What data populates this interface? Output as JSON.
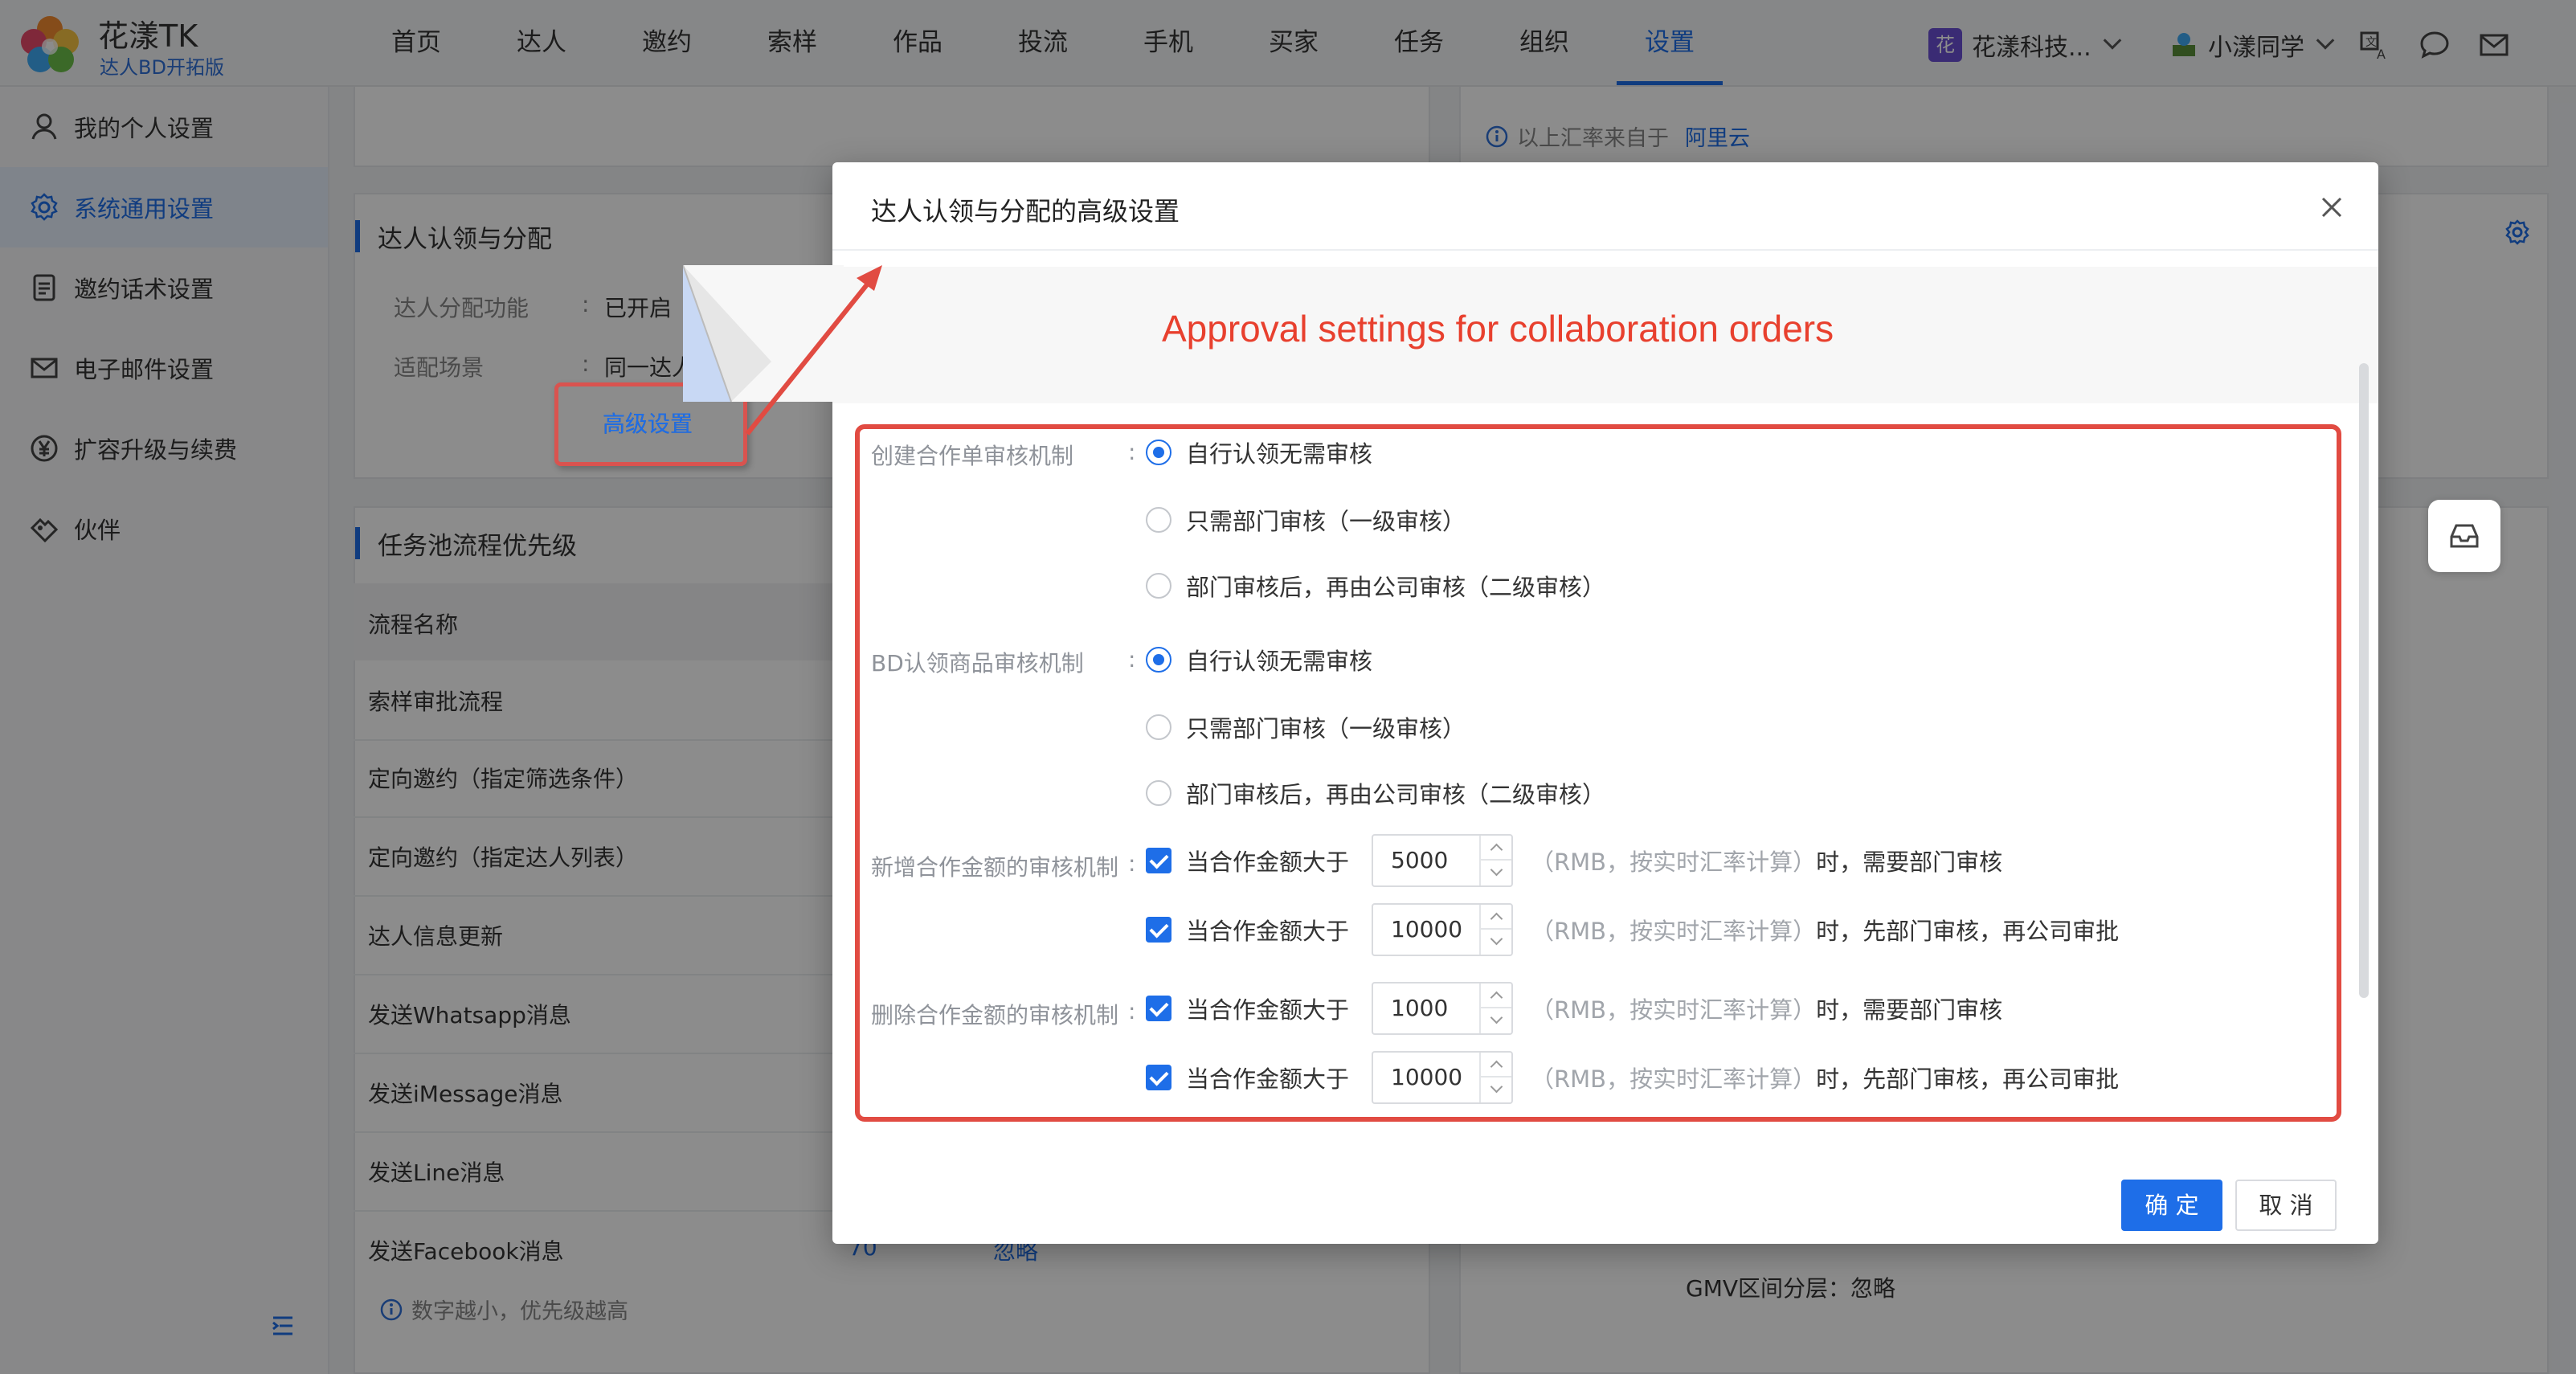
{
  "brand": {
    "name": "花漾TK",
    "sub": "达人BD开拓版"
  },
  "nav": [
    "首页",
    "达人",
    "邀约",
    "索样",
    "作品",
    "投流",
    "手机",
    "买家",
    "任务",
    "组织",
    "设置"
  ],
  "header": {
    "org_badge": "花",
    "org_name": "花漾科技...",
    "user_name": "小漾同学"
  },
  "sidebar": {
    "items": [
      {
        "label": "我的个人设置",
        "icon": "user-icon"
      },
      {
        "label": "系统通用设置",
        "icon": "gear-icon",
        "active": true
      },
      {
        "label": "邀约话术设置",
        "icon": "document-icon"
      },
      {
        "label": "电子邮件设置",
        "icon": "mail-icon"
      },
      {
        "label": "扩容升级与续费",
        "icon": "yen-icon"
      },
      {
        "label": "伙伴",
        "icon": "handshake-icon"
      }
    ]
  },
  "background": {
    "rate_hint": "以上汇率来自于",
    "rate_source": "阿里云",
    "claim_section": {
      "title": "达人认领与分配",
      "function_label": "达人分配功能",
      "function_value": "已开启",
      "scene_label": "适配场景",
      "scene_value": "同一达人",
      "advanced_link": "高级设置"
    },
    "task_section": {
      "title": "任务池流程优先级",
      "column": "流程名称",
      "rows": [
        "索样审批流程",
        "定向邀约（指定筛选条件）",
        "定向邀约（指定达人列表）",
        "达人信息更新",
        "发送Whatsapp消息",
        "发送iMessage消息",
        "发送Line消息",
        "发送Facebook消息"
      ],
      "last_row_priority": "70",
      "last_row_action": "忽略",
      "hint": "数字越小，优先级越高"
    },
    "gmv_text": "GMV区间分层：忽略"
  },
  "modal": {
    "title": "达人认领与分配的高级设置",
    "banner": "Approval settings for collaboration orders",
    "create_order": {
      "label": "创建合作单审核机制",
      "options": [
        "自行认领无需审核",
        "只需部门审核（一级审核）",
        "部门审核后，再由公司审核（二级审核）"
      ],
      "selected": 0
    },
    "bd_claim": {
      "label": "BD认领商品审核机制",
      "options": [
        "自行认领无需审核",
        "只需部门审核（一级审核）",
        "部门审核后，再由公司审核（二级审核）"
      ],
      "selected": 0
    },
    "add_amount": {
      "label": "新增合作金额的审核机制",
      "rows": [
        {
          "prefix": "当合作金额大于",
          "value": "5000",
          "note": "（RMB，按实时汇率计算）",
          "tail": "时，需要部门审核"
        },
        {
          "prefix": "当合作金额大于",
          "value": "10000",
          "note": "（RMB，按实时汇率计算）",
          "tail": "时，先部门审核，再公司审批"
        }
      ]
    },
    "delete_amount": {
      "label": "删除合作金额的审核机制",
      "rows": [
        {
          "prefix": "当合作金额大于",
          "value": "1000",
          "note": "（RMB，按实时汇率计算）",
          "tail": "时，需要部门审核"
        },
        {
          "prefix": "当合作金额大于",
          "value": "10000",
          "note": "（RMB，按实时汇率计算）",
          "tail": "时，先部门审核，再公司审批"
        }
      ]
    },
    "ok_label": "确 定",
    "cancel_label": "取 消"
  },
  "colors": {
    "accent": "#1e6ee8",
    "annotation": "#e14b42"
  }
}
